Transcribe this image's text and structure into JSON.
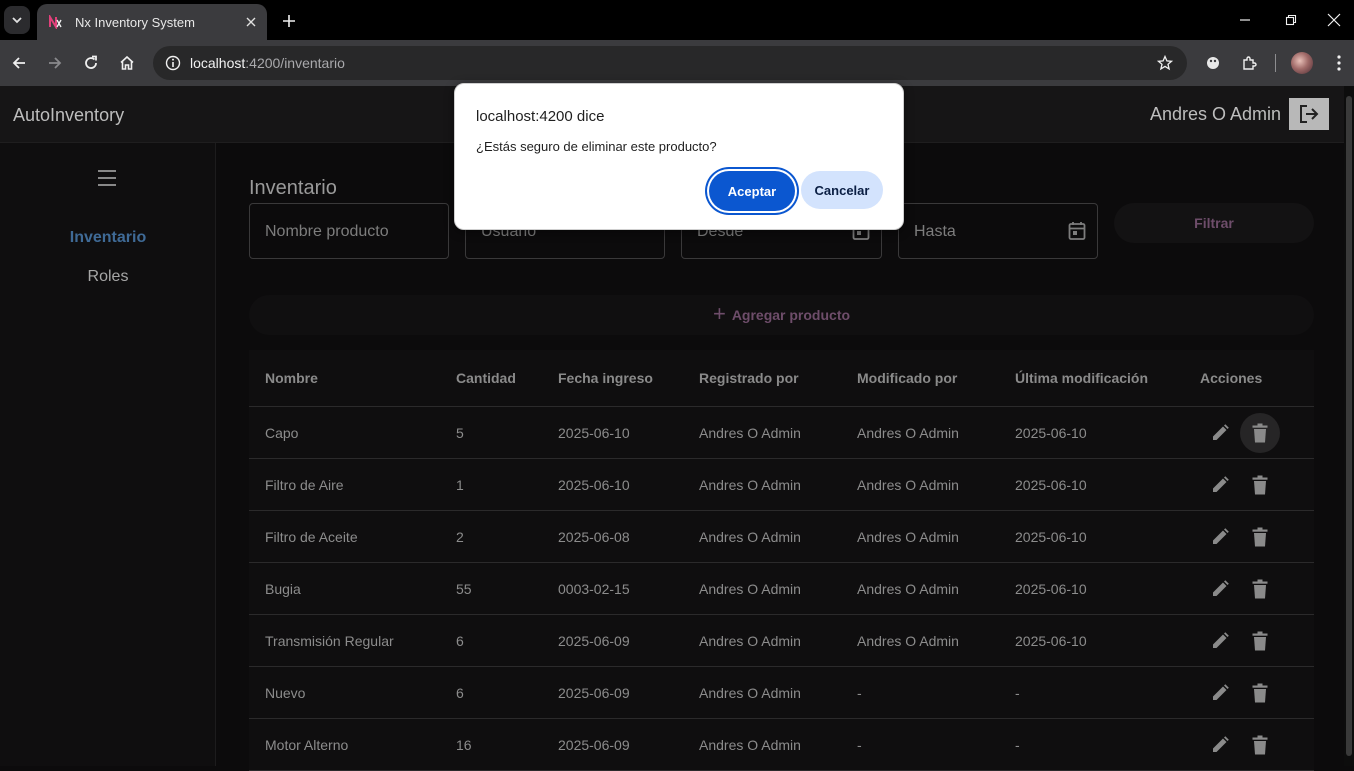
{
  "browser": {
    "tab_title": "Nx Inventory System",
    "url_host": "localhost",
    "url_rest": ":4200/inventario"
  },
  "app": {
    "title": "AutoInventory",
    "user_name": "Andres O Admin"
  },
  "sidebar": {
    "items": [
      {
        "label": "Inventario",
        "active": true
      },
      {
        "label": "Roles",
        "active": false
      }
    ]
  },
  "page": {
    "title": "Inventario",
    "filters": {
      "product_name_placeholder": "Nombre producto",
      "user_placeholder": "Usuario",
      "from_placeholder": "Desde",
      "to_placeholder": "Hasta",
      "filter_button": "Filtrar"
    },
    "add_button": "Agregar producto"
  },
  "table": {
    "headers": [
      "Nombre",
      "Cantidad",
      "Fecha ingreso",
      "Registrado por",
      "Modificado por",
      "Última modificación",
      "Acciones"
    ],
    "rows": [
      [
        "Capo",
        "5",
        "2025-06-10",
        "Andres O Admin",
        "Andres O Admin",
        "2025-06-10"
      ],
      [
        "Filtro de Aire",
        "1",
        "2025-06-10",
        "Andres O Admin",
        "Andres O Admin",
        "2025-06-10"
      ],
      [
        "Filtro de Aceite",
        "2",
        "2025-06-08",
        "Andres O Admin",
        "Andres O Admin",
        "2025-06-10"
      ],
      [
        "Bugia",
        "55",
        "0003-02-15",
        "Andres O Admin",
        "Andres O Admin",
        "2025-06-10"
      ],
      [
        "Transmisión Regular",
        "6",
        "2025-06-09",
        "Andres O Admin",
        "Andres O Admin",
        "2025-06-10"
      ],
      [
        "Nuevo",
        "6",
        "2025-06-09",
        "Andres O Admin",
        "-",
        "-"
      ],
      [
        "Motor Alterno",
        "16",
        "2025-06-09",
        "Andres O Admin",
        "-",
        "-"
      ]
    ]
  },
  "dialog": {
    "title": "localhost:4200 dice",
    "message": "¿Estás seguro de eliminar este producto?",
    "ok_label": "Aceptar",
    "cancel_label": "Cancelar"
  },
  "colors": {
    "accent_active_nav": "#3f6a96",
    "dialog_primary": "#0b57d0",
    "dialog_secondary": "#d3e3fd",
    "button_text": "#6e4d6a"
  }
}
